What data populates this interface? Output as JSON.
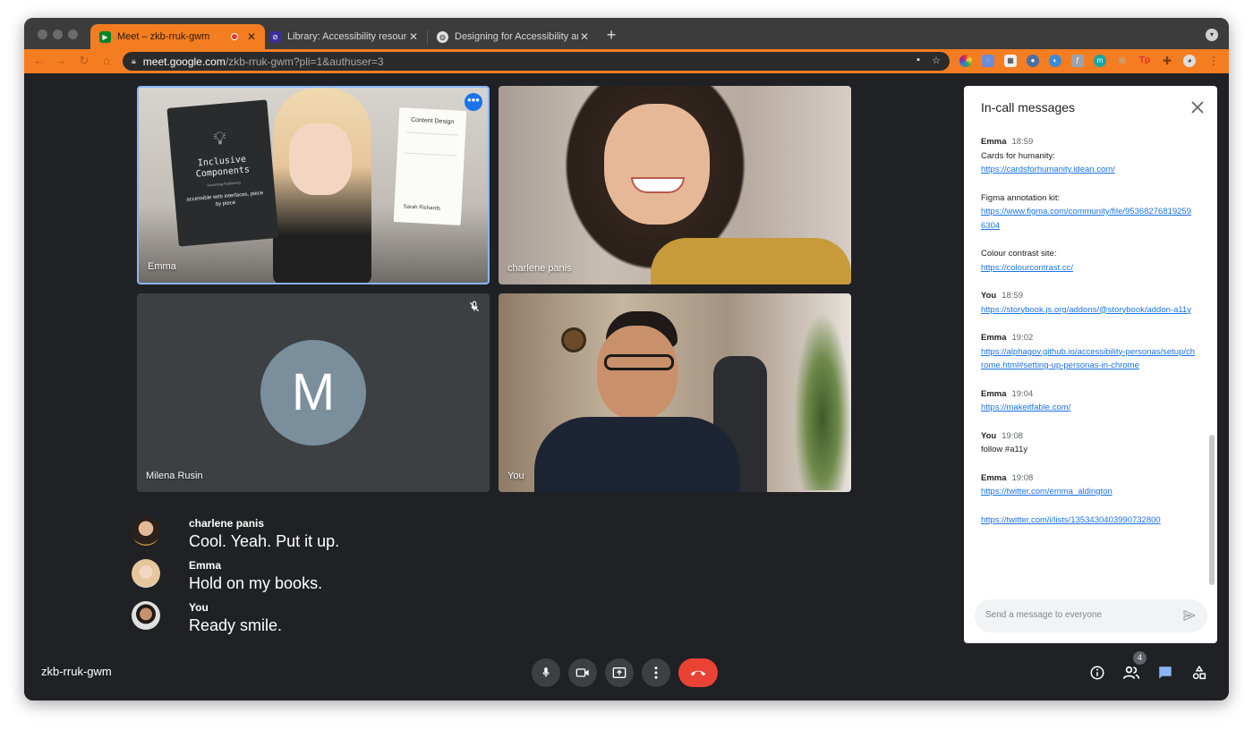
{
  "browser": {
    "tabs": [
      {
        "title": "Meet – zkb-rruk-gwm",
        "active": true
      },
      {
        "title": "Library: Accessibility resources",
        "active": false
      },
      {
        "title": "Designing for Accessibility and...",
        "active": false
      }
    ],
    "new_tab": "+",
    "url_host": "meet.google.com",
    "url_path": "/zkb-rruk-gwm?pli=1&authuser=3"
  },
  "participants": [
    {
      "name": "Emma"
    },
    {
      "name": "charlene panis"
    },
    {
      "name": "Milena Rusin",
      "initial": "M"
    },
    {
      "name": "You"
    }
  ],
  "captions": [
    {
      "speaker": "charlene panis",
      "text": "Cool. Yeah. Put it up."
    },
    {
      "speaker": "Emma",
      "text": "Hold on my books."
    },
    {
      "speaker": "You",
      "text": "Ready smile."
    }
  ],
  "chat": {
    "title": "In-call messages",
    "placeholder": "Send a message to everyone",
    "messages": [
      {
        "sender": "Emma",
        "time": "18:59",
        "lines": [
          {
            "text": "Cards for humanity:",
            "link": false
          },
          {
            "text": "https://cardsforhumanity.idean.com/",
            "link": true
          }
        ]
      },
      {
        "sender": "",
        "time": "",
        "lines": [
          {
            "text": "Figma annotation kit:",
            "link": false
          },
          {
            "text": "https://www.figma.com/community/file/953682768192596304",
            "link": true
          }
        ]
      },
      {
        "sender": "",
        "time": "",
        "lines": [
          {
            "text": "Colour contrast site:",
            "link": false
          },
          {
            "text": "https://colourcontrast.cc/",
            "link": true
          }
        ]
      },
      {
        "sender": "You",
        "time": "18:59",
        "lines": [
          {
            "text": "https://storybook.js.org/addons/@storybook/addon-a11y",
            "link": true
          }
        ]
      },
      {
        "sender": "Emma",
        "time": "19:02",
        "lines": [
          {
            "text": "https://alphagov.github.io/accessibility-personas/setup/chrome.html#setting-up-personas-in-chrome",
            "link": true
          }
        ]
      },
      {
        "sender": "Emma",
        "time": "19:04",
        "lines": [
          {
            "text": "https://makeitfable.com/",
            "link": true
          }
        ]
      },
      {
        "sender": "You",
        "time": "19:08",
        "lines": [
          {
            "text": "follow #a11y",
            "link": false
          }
        ]
      },
      {
        "sender": "Emma",
        "time": "19:08",
        "lines": [
          {
            "text": "https://twitter.com/emma_aldington",
            "link": true
          }
        ]
      },
      {
        "sender": "",
        "time": "",
        "lines": [
          {
            "text": "https://twitter.com/i/lists/1353430403990732800",
            "link": true
          }
        ]
      }
    ]
  },
  "bottom_bar": {
    "meeting_code": "zkb-rruk-gwm",
    "participant_count": "4"
  },
  "book_left": {
    "title": "Inclusive Components",
    "subtitle": "accessible web interfaces, piece by piece",
    "publisher": "Smashing Publishing"
  },
  "book_right": {
    "title": "Content Design",
    "author": "Sarah Richards"
  },
  "colors": {
    "accent": "#f47d21",
    "meet_bg": "#202124",
    "end_call": "#ea4335",
    "link": "#1a73e8"
  }
}
